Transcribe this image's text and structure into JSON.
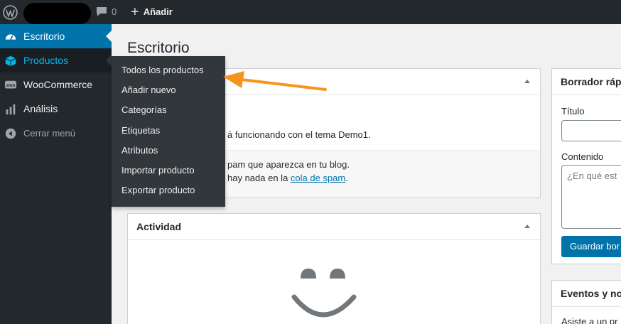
{
  "adminbar": {
    "comments_count": "0",
    "new_label": "Añadir"
  },
  "sidebar": {
    "items": [
      {
        "label": "Escritorio",
        "icon": "dashboard-icon"
      },
      {
        "label": "Productos",
        "icon": "cube-icon"
      },
      {
        "label": "WooCommerce",
        "icon": "woocommerce-icon"
      },
      {
        "label": "Análisis",
        "icon": "chart-icon"
      },
      {
        "label": "Cerrar menú",
        "icon": "collapse-icon"
      }
    ]
  },
  "flyout": {
    "items": [
      "Todos los productos",
      "Añadir nuevo",
      "Categorías",
      "Etiquetas",
      "Atributos",
      "Importar producto",
      "Exportar producto"
    ]
  },
  "page": {
    "title": "Escritorio"
  },
  "glance": {
    "theme_line": "á funcionando con el tema Demo1.",
    "spam_line1": "pam que aparezca en tu blog.",
    "spam_line2_prefix": "hay nada en la ",
    "spam_link": "cola de spam",
    "spam_line2_suffix": "."
  },
  "activity": {
    "title": "Actividad"
  },
  "quick_draft": {
    "title": "Borrador ráp",
    "title_label": "Título",
    "content_label": "Contenido",
    "content_placeholder": "¿En qué est",
    "save_button": "Guardar bor"
  },
  "events": {
    "title": "Eventos y no",
    "desc": "Asiste a un pr"
  },
  "colors": {
    "admin_bg": "#23282d",
    "accent": "#0073aa",
    "hover_text": "#00b9eb",
    "annotation_arrow": "#f7941d"
  }
}
